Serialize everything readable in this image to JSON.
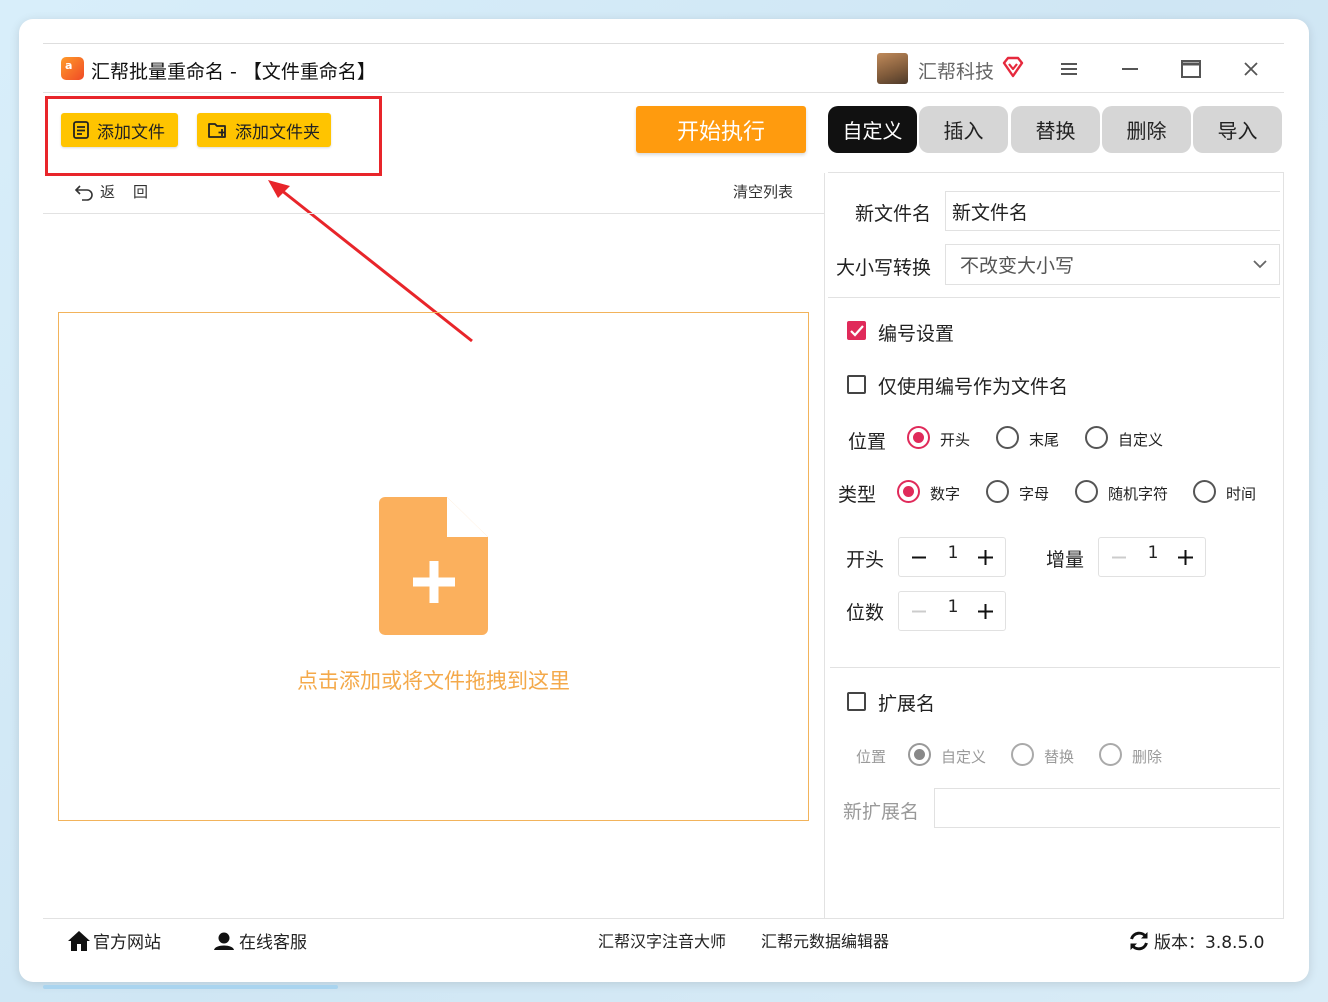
{
  "window": {
    "app_title": "汇帮批量重命名 - 【文件重命名】",
    "logo_text": "a",
    "brand_name": "汇帮科技"
  },
  "toolbar": {
    "add_file": "添加文件",
    "add_folder": "添加文件夹",
    "start": "开始执行"
  },
  "tabs": [
    "自定义",
    "插入",
    "替换",
    "删除",
    "导入"
  ],
  "list": {
    "back": "返",
    "back_glyph": "回",
    "clear": "清空列表",
    "drop_hint": "点击添加或将文件拖拽到这里"
  },
  "settings": {
    "new_name_label": "新文件名",
    "new_name_value": "新文件名",
    "case_label": "大小写转换",
    "case_value": "不改变大小写",
    "numbering_label": "编号设置",
    "numbering_checked": true,
    "only_number_label": "仅使用编号作为文件名",
    "only_number_checked": false,
    "position_label": "位置",
    "position_options": [
      "开头",
      "末尾",
      "自定义"
    ],
    "position_selected": "开头",
    "type_label": "类型",
    "type_options": [
      "数字",
      "字母",
      "随机字符",
      "时间"
    ],
    "type_selected": "数字",
    "start_label": "开头",
    "start_value": "1",
    "increment_label": "增量",
    "increment_value": "1",
    "digits_label": "位数",
    "digits_value": "1",
    "extension_label": "扩展名",
    "extension_checked": false,
    "ext_position_label": "位置",
    "ext_options": [
      "自定义",
      "替换",
      "删除"
    ],
    "ext_selected": "自定义",
    "new_ext_label": "新扩展名",
    "new_ext_value": ""
  },
  "footer": {
    "website": "官方网站",
    "support": "在线客服",
    "product1": "汇帮汉字注音大师",
    "product2": "汇帮元数据编辑器",
    "version": "版本：3.8.5.0"
  },
  "colors": {
    "accent_yellow": "#ffc400",
    "start_orange": "#ff9b0e",
    "check_red": "#e02a5a",
    "annotation_red": "#e8252a",
    "drop_orange": "#f4a94a"
  }
}
